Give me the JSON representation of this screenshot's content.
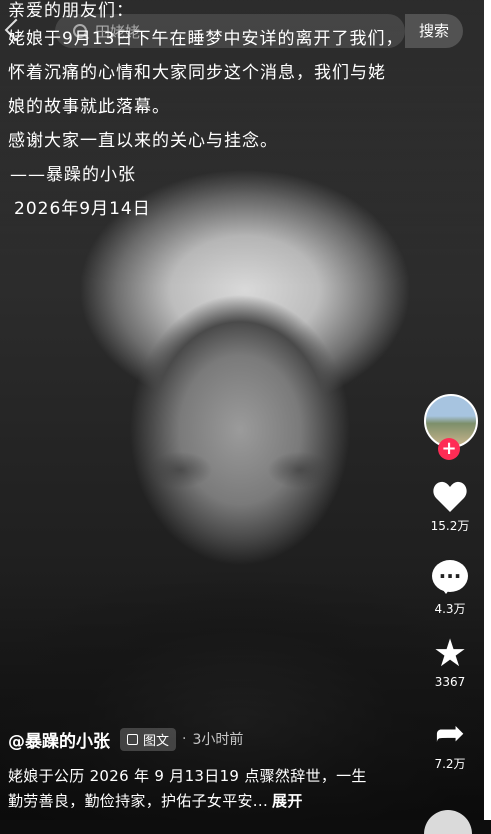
{
  "search": {
    "query": "田姥姥",
    "button_label": "搜索"
  },
  "notice": {
    "lines": [
      "亲爱的朋友们：",
      "姥娘于9月13日下午在睡梦中安详的离开了我们，",
      "怀着沉痛的心情和大家同步这个消息，我们与姥",
      "娘的故事就此落幕。",
      "感谢大家一直以来的关心与挂念。",
      "——暴躁的小张",
      "2026年9月14日"
    ]
  },
  "actions": {
    "follow_label": "+",
    "likes": "15.2万",
    "comments": "4.3万",
    "favorites": "3367",
    "shares": "7.2万"
  },
  "post": {
    "author": "@暴躁的小张",
    "type_tag": "图文",
    "separator": "·",
    "time": "3小时前",
    "description": "姥娘于公历 2026 年 9 月13日19 点骤然辞世，一生勤劳善良，勤俭持家，护佑子女平安...",
    "expand_label": "展开"
  },
  "icons": {
    "back": "back-arrow-icon",
    "search": "search-icon",
    "like": "heart-icon",
    "comment": "comment-icon",
    "favorite": "star-icon",
    "share": "share-icon"
  },
  "colors": {
    "follow_badge": "#fe2c55",
    "text": "#ffffff"
  }
}
